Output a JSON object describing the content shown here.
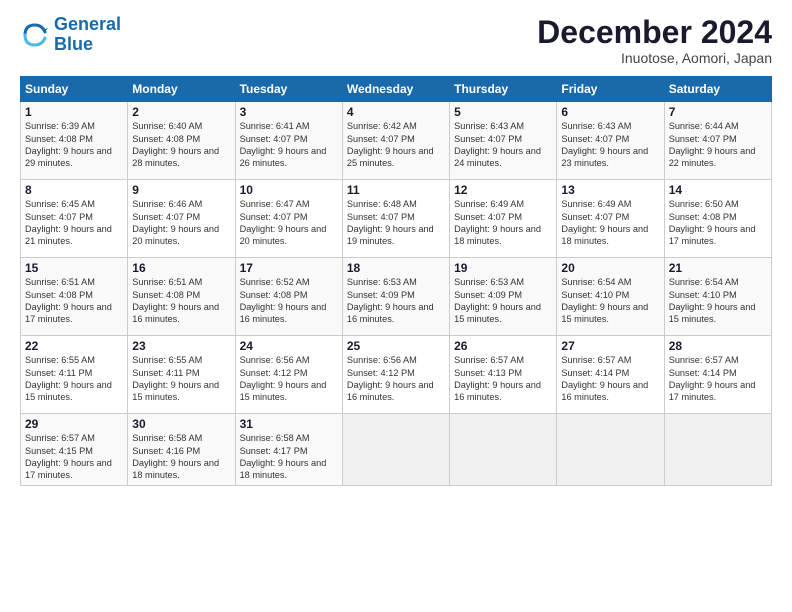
{
  "header": {
    "logo_line1": "General",
    "logo_line2": "Blue",
    "month_title": "December 2024",
    "subtitle": "Inuotose, Aomori, Japan"
  },
  "weekdays": [
    "Sunday",
    "Monday",
    "Tuesday",
    "Wednesday",
    "Thursday",
    "Friday",
    "Saturday"
  ],
  "weeks": [
    [
      {
        "day": "1",
        "sunrise": "6:39 AM",
        "sunset": "4:08 PM",
        "daylight": "9 hours and 29 minutes."
      },
      {
        "day": "2",
        "sunrise": "6:40 AM",
        "sunset": "4:08 PM",
        "daylight": "9 hours and 28 minutes."
      },
      {
        "day": "3",
        "sunrise": "6:41 AM",
        "sunset": "4:07 PM",
        "daylight": "9 hours and 26 minutes."
      },
      {
        "day": "4",
        "sunrise": "6:42 AM",
        "sunset": "4:07 PM",
        "daylight": "9 hours and 25 minutes."
      },
      {
        "day": "5",
        "sunrise": "6:43 AM",
        "sunset": "4:07 PM",
        "daylight": "9 hours and 24 minutes."
      },
      {
        "day": "6",
        "sunrise": "6:43 AM",
        "sunset": "4:07 PM",
        "daylight": "9 hours and 23 minutes."
      },
      {
        "day": "7",
        "sunrise": "6:44 AM",
        "sunset": "4:07 PM",
        "daylight": "9 hours and 22 minutes."
      }
    ],
    [
      {
        "day": "8",
        "sunrise": "6:45 AM",
        "sunset": "4:07 PM",
        "daylight": "9 hours and 21 minutes."
      },
      {
        "day": "9",
        "sunrise": "6:46 AM",
        "sunset": "4:07 PM",
        "daylight": "9 hours and 20 minutes."
      },
      {
        "day": "10",
        "sunrise": "6:47 AM",
        "sunset": "4:07 PM",
        "daylight": "9 hours and 20 minutes."
      },
      {
        "day": "11",
        "sunrise": "6:48 AM",
        "sunset": "4:07 PM",
        "daylight": "9 hours and 19 minutes."
      },
      {
        "day": "12",
        "sunrise": "6:49 AM",
        "sunset": "4:07 PM",
        "daylight": "9 hours and 18 minutes."
      },
      {
        "day": "13",
        "sunrise": "6:49 AM",
        "sunset": "4:07 PM",
        "daylight": "9 hours and 18 minutes."
      },
      {
        "day": "14",
        "sunrise": "6:50 AM",
        "sunset": "4:08 PM",
        "daylight": "9 hours and 17 minutes."
      }
    ],
    [
      {
        "day": "15",
        "sunrise": "6:51 AM",
        "sunset": "4:08 PM",
        "daylight": "9 hours and 17 minutes."
      },
      {
        "day": "16",
        "sunrise": "6:51 AM",
        "sunset": "4:08 PM",
        "daylight": "9 hours and 16 minutes."
      },
      {
        "day": "17",
        "sunrise": "6:52 AM",
        "sunset": "4:08 PM",
        "daylight": "9 hours and 16 minutes."
      },
      {
        "day": "18",
        "sunrise": "6:53 AM",
        "sunset": "4:09 PM",
        "daylight": "9 hours and 16 minutes."
      },
      {
        "day": "19",
        "sunrise": "6:53 AM",
        "sunset": "4:09 PM",
        "daylight": "9 hours and 15 minutes."
      },
      {
        "day": "20",
        "sunrise": "6:54 AM",
        "sunset": "4:10 PM",
        "daylight": "9 hours and 15 minutes."
      },
      {
        "day": "21",
        "sunrise": "6:54 AM",
        "sunset": "4:10 PM",
        "daylight": "9 hours and 15 minutes."
      }
    ],
    [
      {
        "day": "22",
        "sunrise": "6:55 AM",
        "sunset": "4:11 PM",
        "daylight": "9 hours and 15 minutes."
      },
      {
        "day": "23",
        "sunrise": "6:55 AM",
        "sunset": "4:11 PM",
        "daylight": "9 hours and 15 minutes."
      },
      {
        "day": "24",
        "sunrise": "6:56 AM",
        "sunset": "4:12 PM",
        "daylight": "9 hours and 15 minutes."
      },
      {
        "day": "25",
        "sunrise": "6:56 AM",
        "sunset": "4:12 PM",
        "daylight": "9 hours and 16 minutes."
      },
      {
        "day": "26",
        "sunrise": "6:57 AM",
        "sunset": "4:13 PM",
        "daylight": "9 hours and 16 minutes."
      },
      {
        "day": "27",
        "sunrise": "6:57 AM",
        "sunset": "4:14 PM",
        "daylight": "9 hours and 16 minutes."
      },
      {
        "day": "28",
        "sunrise": "6:57 AM",
        "sunset": "4:14 PM",
        "daylight": "9 hours and 17 minutes."
      }
    ],
    [
      {
        "day": "29",
        "sunrise": "6:57 AM",
        "sunset": "4:15 PM",
        "daylight": "9 hours and 17 minutes."
      },
      {
        "day": "30",
        "sunrise": "6:58 AM",
        "sunset": "4:16 PM",
        "daylight": "9 hours and 18 minutes."
      },
      {
        "day": "31",
        "sunrise": "6:58 AM",
        "sunset": "4:17 PM",
        "daylight": "9 hours and 18 minutes."
      },
      null,
      null,
      null,
      null
    ]
  ]
}
